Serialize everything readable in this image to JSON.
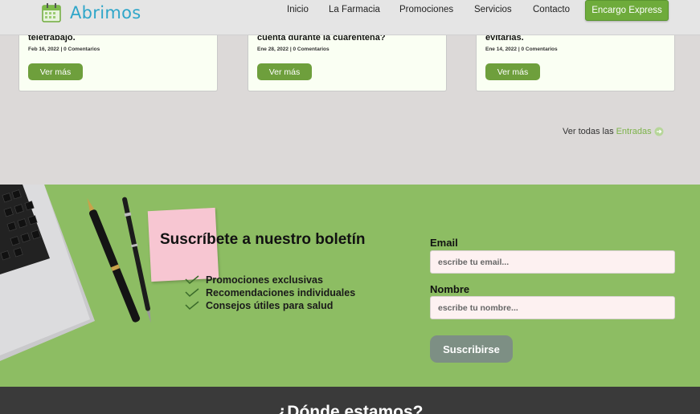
{
  "header": {
    "brand": "Abrimos",
    "nav": [
      "Inicio",
      "La Farmacia",
      "Promociones",
      "Servicios",
      "Contacto"
    ],
    "cta": "Encargo Express"
  },
  "blog": {
    "cards": [
      {
        "title": "teletrabajo.",
        "meta": "Feb 16, 2022 | 0 Comentarios",
        "button": "Ver más"
      },
      {
        "title": "cuenta durante la cuarentena?",
        "meta": "Ene 28, 2022 | 0 Comentarios",
        "button": "Ver más"
      },
      {
        "title": "evitarlas.",
        "meta": "Ene 14, 2022 | 0 Comentarios",
        "button": "Ver más"
      }
    ],
    "see_all_prefix": "Ver todas las",
    "see_all_link": "Entradas"
  },
  "newsletter": {
    "title": "Suscríbete a nuestro boletín",
    "benefits": [
      "Promociones exclusivas",
      "Recomendaciones individuales",
      "Consejos útiles para salud"
    ],
    "email_label": "Email",
    "email_placeholder": "escribe tu email...",
    "name_label": "Nombre",
    "name_placeholder": "escribe tu nombre...",
    "submit": "Suscribirse"
  },
  "footer": {
    "title": "¿Dónde estamos?"
  },
  "colors": {
    "brand": "#2fa6c9",
    "accent_green": "#6eab3b",
    "newsletter_bg": "#8dbd63",
    "footer_bg": "#3a3a3a"
  }
}
